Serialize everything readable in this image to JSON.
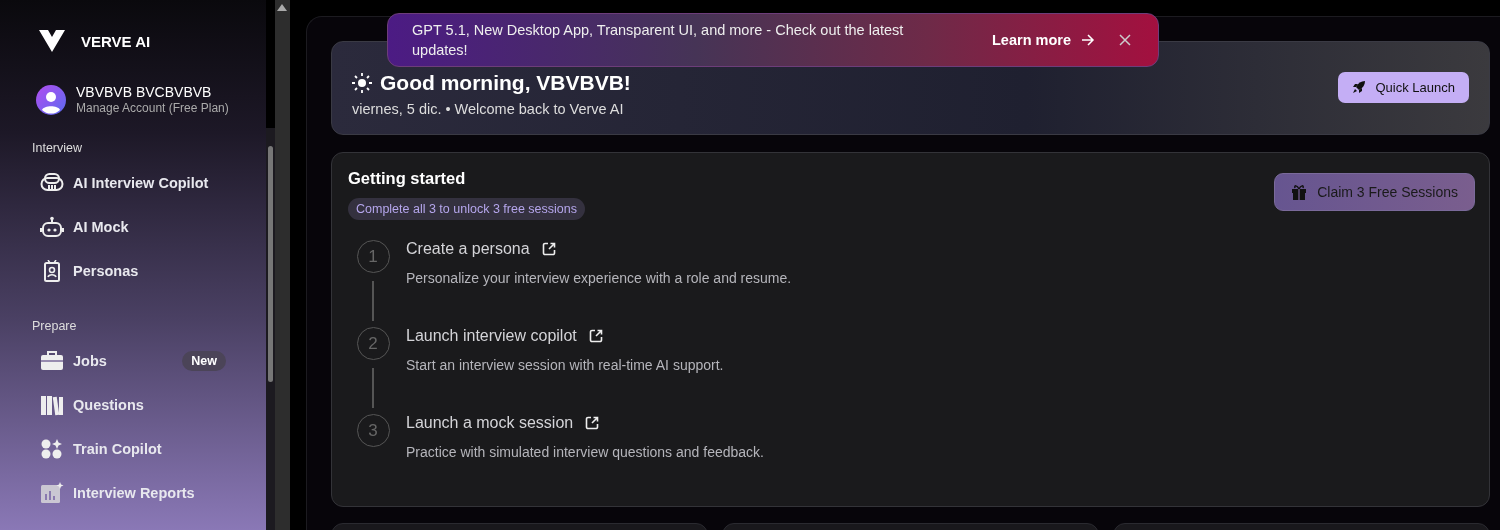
{
  "brand": {
    "name": "VERVE AI"
  },
  "account": {
    "name": "VBVBVB BVCBVBVB",
    "plan": "Manage Account (Free Plan)"
  },
  "sidebar": {
    "sections": [
      {
        "title": "Interview",
        "items": [
          {
            "label": "AI Interview Copilot",
            "kind": "copilot"
          },
          {
            "label": "AI Mock",
            "kind": "robot"
          },
          {
            "label": "Personas",
            "kind": "badge"
          }
        ]
      },
      {
        "title": "Prepare",
        "items": [
          {
            "label": "Jobs",
            "kind": "briefcase",
            "badge": "New"
          },
          {
            "label": "Questions",
            "kind": "books"
          },
          {
            "label": "Train Copilot",
            "kind": "shapes"
          },
          {
            "label": "Interview Reports",
            "kind": "report"
          }
        ]
      }
    ]
  },
  "banner": {
    "text": "GPT 5.1, New Desktop App, Transparent UI, and more - Check out the latest updates!",
    "link": "Learn more"
  },
  "greeting": {
    "title": "Good morning, VBVBVB!",
    "subtitle": "viernes, 5 dic. • Welcome back to Verve AI",
    "button": "Quick Launch"
  },
  "getting_started": {
    "title": "Getting started",
    "hint": "Complete all 3 to unlock 3 free sessions",
    "button": "Claim 3 Free Sessions",
    "steps": [
      {
        "number": "1",
        "title": "Create a persona",
        "description": "Personalize your interview experience with a role and resume."
      },
      {
        "number": "2",
        "title": "Launch interview copilot",
        "description": "Start an interview session with real-time AI support."
      },
      {
        "number": "3",
        "title": "Launch a mock session",
        "description": "Practice with simulated interview questions and feedback."
      }
    ]
  }
}
